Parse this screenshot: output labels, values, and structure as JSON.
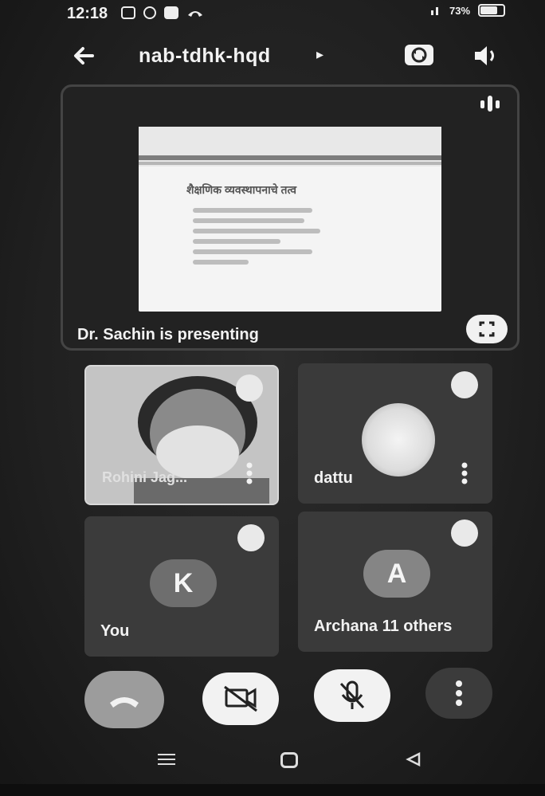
{
  "status_bar": {
    "time": "12:18",
    "battery": "73%",
    "icons": [
      "sim-icon",
      "settings-icon",
      "gallery-icon",
      "phone-icon",
      "signal-icon",
      "battery-icon"
    ]
  },
  "app_bar": {
    "meeting_code": "nab-tdhk-hqd",
    "caret": "▸",
    "icons": [
      "back-arrow-icon",
      "switch-camera-icon",
      "speaker-icon"
    ]
  },
  "presentation": {
    "label": "Dr. Sachin is presenting",
    "slide_title": "शैक्षणिक व्यवस्थापनाचे तत्व"
  },
  "participants": [
    {
      "name": "Rohini Jag...",
      "type": "camera",
      "muted": true
    },
    {
      "name": "dattu",
      "type": "photo-avatar",
      "muted": true
    },
    {
      "name": "You",
      "type": "initial",
      "initial": "K",
      "muted": true
    },
    {
      "name": "Archana 11 others",
      "type": "initial",
      "initial": "A",
      "muted": true
    }
  ],
  "controls": {
    "icons": [
      "end-call-icon",
      "camera-off-icon",
      "mic-off-icon",
      "more-options-icon"
    ]
  },
  "colors": {
    "background": "#1e1e1e",
    "tile": "#3a3a3a",
    "button_light": "#f2f2f2",
    "end_call": "#9c9c9c"
  }
}
